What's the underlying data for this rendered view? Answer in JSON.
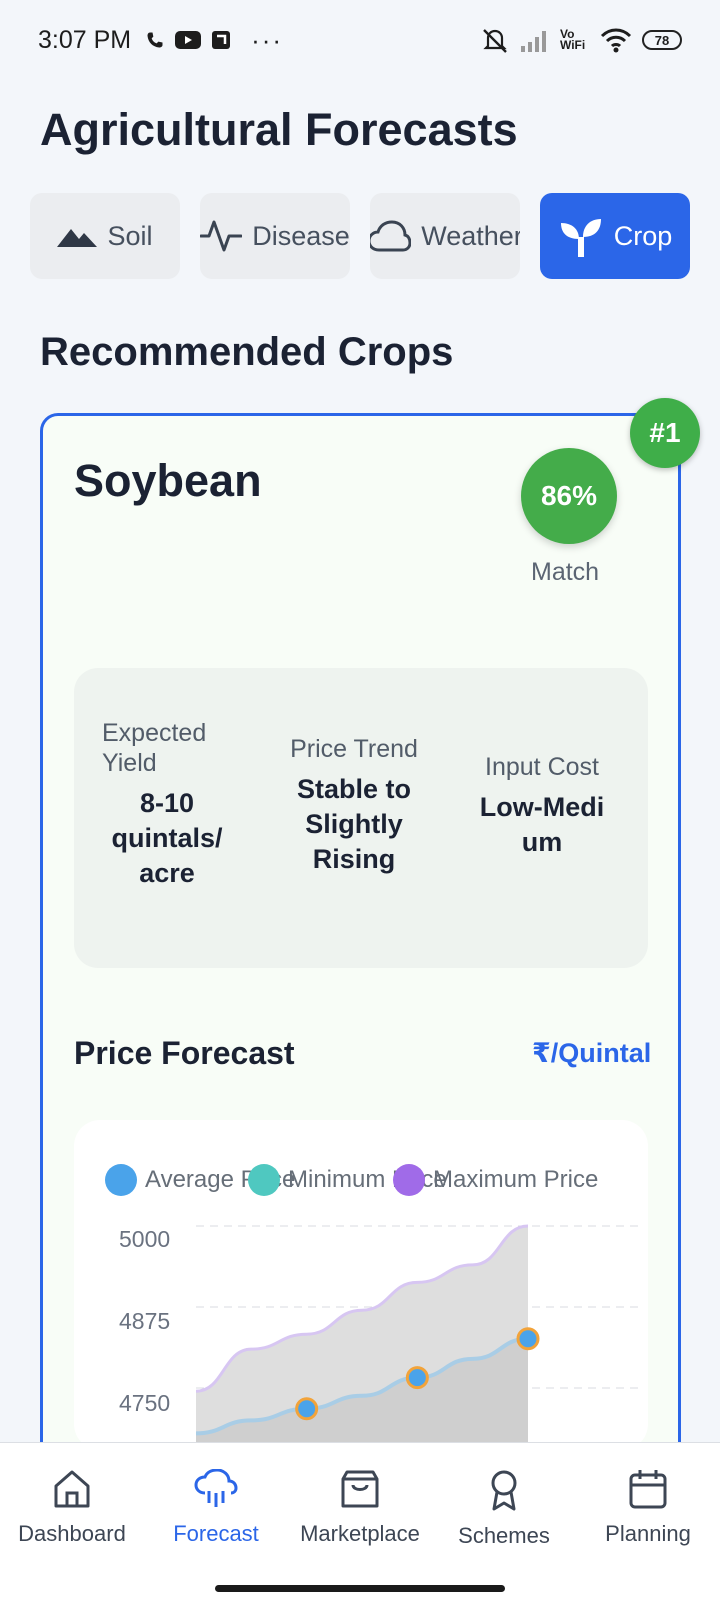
{
  "status_bar": {
    "time": "3:07 PM",
    "more": "···",
    "network_label": "Vo WiFi",
    "battery": "78"
  },
  "header": {
    "title": "Agricultural Forecasts"
  },
  "tabs": [
    {
      "label": "Soil",
      "icon": "mountain-icon",
      "active": false
    },
    {
      "label": "Disease",
      "icon": "activity-icon",
      "active": false
    },
    {
      "label": "Weather",
      "icon": "cloud-icon",
      "active": false
    },
    {
      "label": "Crop",
      "icon": "sprout-icon",
      "active": true
    }
  ],
  "section_title": "Recommended Crops",
  "crop_card": {
    "rank": "#1",
    "name": "Soybean",
    "match_percent": "86%",
    "match_label": "Match",
    "stats": [
      {
        "label": "Expected Yield",
        "value": "8-10 quintals/ acre"
      },
      {
        "label": "Price Trend",
        "value": "Stable to Slightly Rising"
      },
      {
        "label": "Input Cost",
        "value": "Low-Medi um"
      }
    ],
    "price_forecast": {
      "title": "Price Forecast",
      "unit": "₹/Quintal"
    }
  },
  "chart_data": {
    "type": "area",
    "legend": [
      {
        "name": "Average Price",
        "color": "#4aa3ea"
      },
      {
        "name": "Minimum Price",
        "color": "#4fc8c0"
      },
      {
        "name": "Maximum Price",
        "color": "#a06be8"
      }
    ],
    "yticks": [
      5000,
      4875,
      4750
    ],
    "ylim": [
      4700,
      5000
    ],
    "series": [
      {
        "name": "Maximum Price",
        "values": [
          4745,
          4810,
          4833,
          4870,
          4913,
          4940,
          5000
        ]
      },
      {
        "name": "Average Price",
        "values": [
          4680,
          4700,
          4718,
          4738,
          4766,
          4795,
          4826
        ]
      }
    ],
    "markers": [
      {
        "series": "Average Price",
        "values": [
          4718,
          4766,
          4826
        ]
      }
    ],
    "grid": true
  },
  "bottom_nav": [
    {
      "label": "Dashboard",
      "icon": "home-icon",
      "active": false
    },
    {
      "label": "Forecast",
      "icon": "rain-cloud-icon",
      "active": true
    },
    {
      "label": "Marketplace",
      "icon": "shopping-bag-icon",
      "active": false
    },
    {
      "label": "Schemes",
      "icon": "award-icon",
      "active": false
    },
    {
      "label": "Planning",
      "icon": "calendar-icon",
      "active": false
    }
  ],
  "colors": {
    "primary": "#2b66e8",
    "match_green": "#44ac4a",
    "card_bg": "#f8fdf7"
  }
}
